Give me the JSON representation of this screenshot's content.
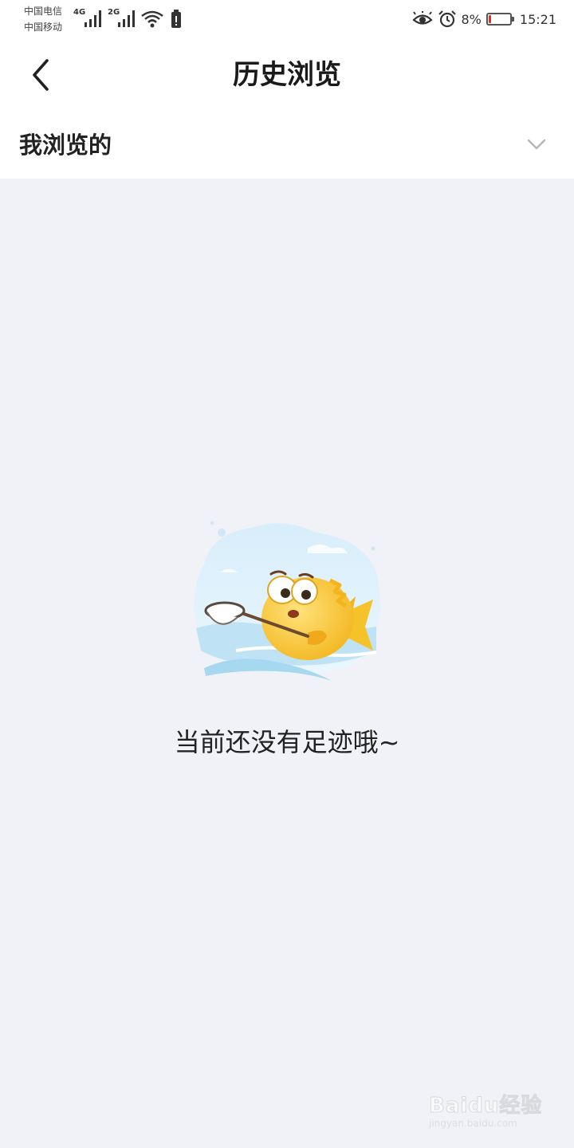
{
  "status_bar": {
    "carrier_1": "中国电信",
    "carrier_2": "中国移动",
    "net_1": "4G",
    "net_2": "2G",
    "battery_percent": "8%",
    "battery_level": 0.08,
    "time": "15:21"
  },
  "header": {
    "title": "历史浏览"
  },
  "filter": {
    "label": "我浏览的"
  },
  "empty_state": {
    "message": "当前还没有足迹哦~"
  },
  "watermark": {
    "brand": "Baidu经验",
    "url": "jingyan.baidu.com"
  },
  "colors": {
    "background": "#f0f2f7",
    "header_bg": "#ffffff",
    "battery_low": "#e0302a",
    "fish": "#f7c93a"
  }
}
